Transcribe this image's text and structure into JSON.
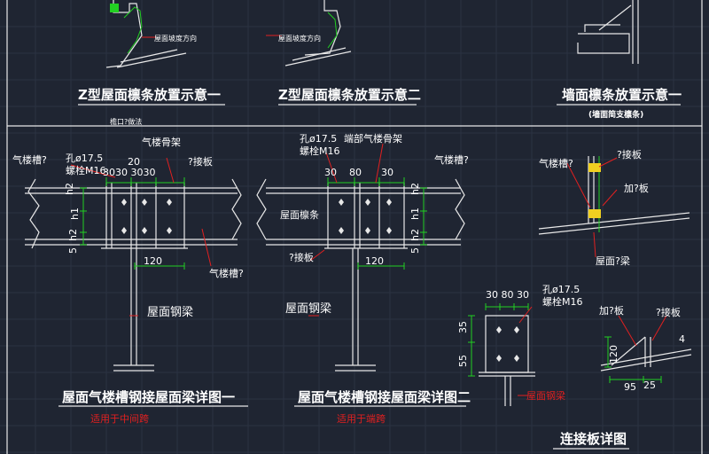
{
  "titles": {
    "z_purlin_1": "Z型屋面檩条放置示意一",
    "z_purlin_2": "Z型屋面檩条放置示意二",
    "wall_purlin": "墙面檩条放置示意一",
    "wall_purlin_sub": "(墙面简支檩条)",
    "eave_note": "檐口?做法",
    "detail_1": "屋面气楼槽钢接屋面梁详图一",
    "detail_1_note": "适用于中间跨",
    "detail_2": "屋面气楼槽钢接屋面梁详图二",
    "detail_2_note": "适用于端跨",
    "plate_detail": "连接板详图"
  },
  "top_labels": {
    "slope_dir_1": "屋面坡度方向",
    "slope_dir_2": "屋面坡度方向"
  },
  "detail_1": {
    "vent_channel_left": "气楼槽?",
    "bolt_hole": "孔ø17.5",
    "bolt": "螺栓M16",
    "vent_frame": "气楼骨架",
    "connection_plate": "?接板",
    "dim_20": "20",
    "dim_spacing": "3030  3030",
    "h2": "h2",
    "h1": "h1",
    "h2b": "h2",
    "dim_5": "5",
    "dim_120": "120",
    "vent_channel_right": "气楼槽?",
    "roof_beam": "屋面钢梁"
  },
  "detail_2": {
    "bolt_hole": "孔ø17.5",
    "bolt": "螺栓M16",
    "end_vent_frame": "端部气楼骨架",
    "vent_channel_right": "气楼槽?",
    "dim_30": "30",
    "dim_80": "80",
    "dim_30b": "30",
    "roof_purlin": "屋面檩条",
    "h2": "h2",
    "h1": "h1",
    "h2b": "h2",
    "dim_5": "5",
    "connection_plate": "?接板",
    "dim_120": "120",
    "roof_beam": "屋面钢梁"
  },
  "wall_detail": {
    "vent_channel": "气楼槽?",
    "connection_plate": "?接板",
    "stiffener": "加?板",
    "roof_beam": "屋面?梁"
  },
  "plate": {
    "dims_top": "30 80 30",
    "bolt_hole": "孔ø17.5",
    "bolt": "螺栓M16",
    "dim_35": "35",
    "dim_55": "55",
    "roof_beam": "屋面钢梁",
    "stiffener": "加?板",
    "connection_plate": "?接板",
    "dim_120": "120",
    "dim_4": "4",
    "dim_95": "95",
    "dim_25": "25"
  }
}
